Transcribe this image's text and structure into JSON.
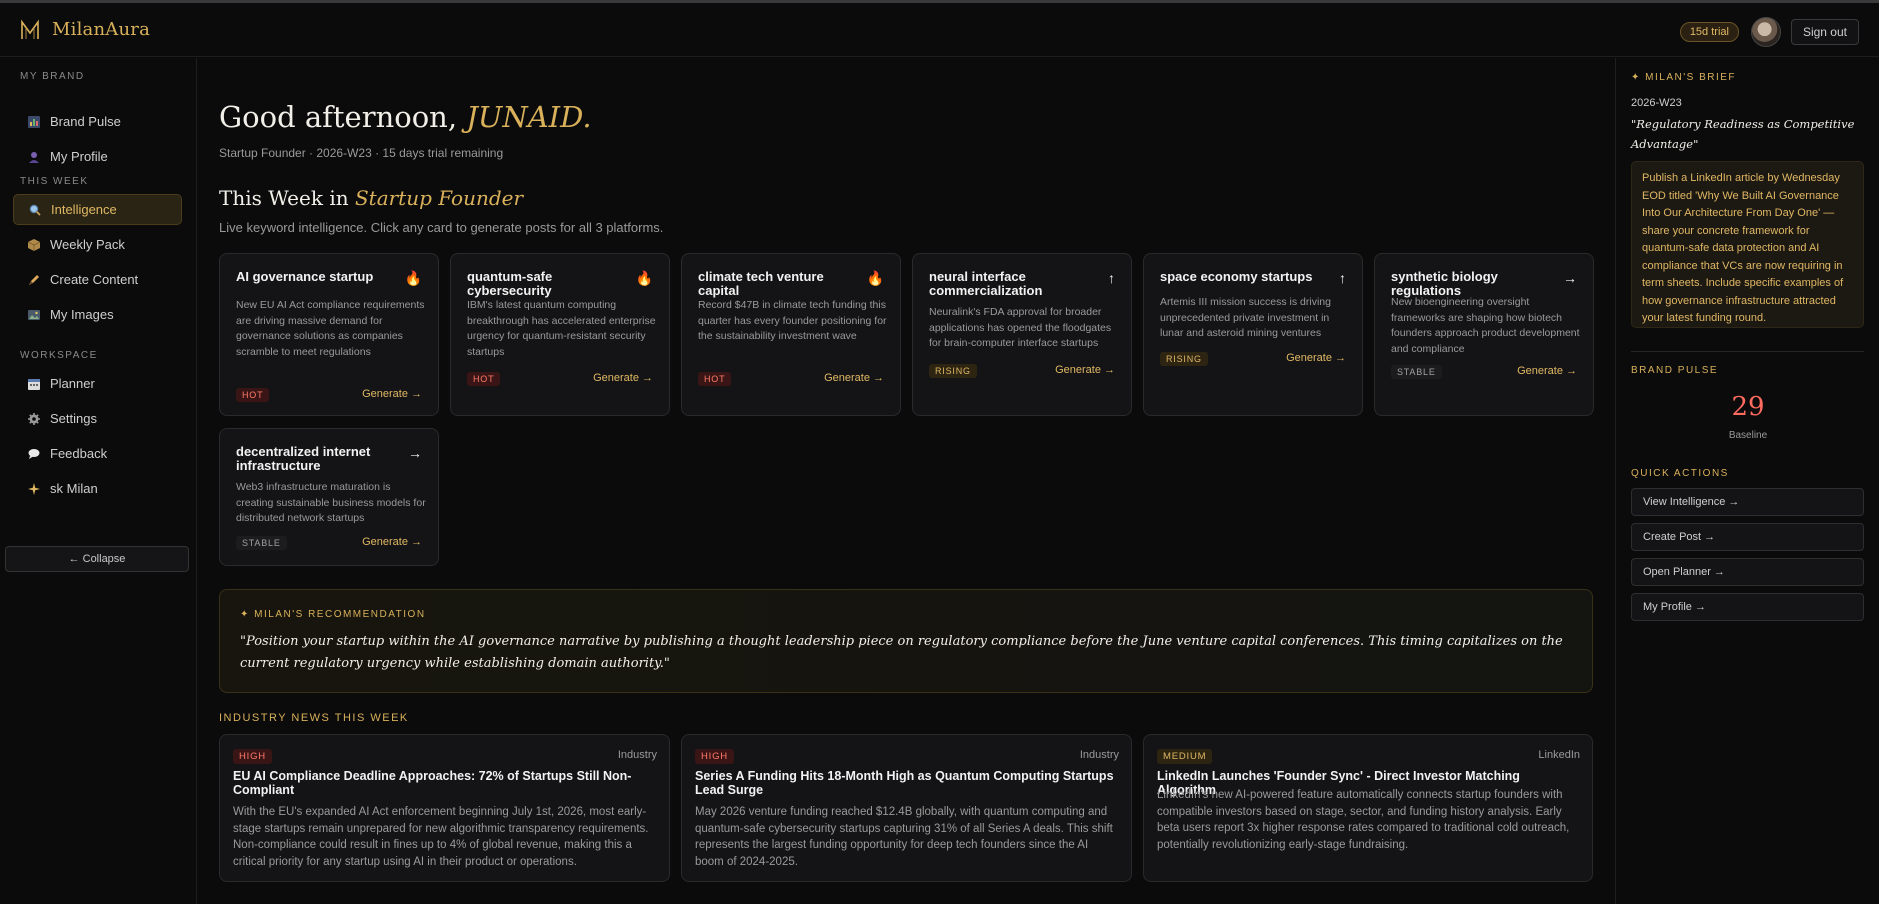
{
  "app": {
    "name": "MilanAura",
    "trial_badge": "15d trial",
    "signout": "Sign out"
  },
  "sidebar": {
    "sections": [
      {
        "label": "MY BRAND"
      },
      {
        "label": "THIS WEEK"
      },
      {
        "label": "WORKSPACE"
      }
    ],
    "items": [
      {
        "label": "Brand Pulse",
        "icon": "chart-icon"
      },
      {
        "label": "My Profile",
        "icon": "user-icon"
      },
      {
        "label": "Intelligence",
        "icon": "search-icon",
        "active": true
      },
      {
        "label": "Weekly Pack",
        "icon": "package-icon"
      },
      {
        "label": "Create Content",
        "icon": "pen-icon"
      },
      {
        "label": "My Images",
        "icon": "image-icon"
      },
      {
        "label": "Planner",
        "icon": "calendar-icon"
      },
      {
        "label": "Settings",
        "icon": "gear-icon"
      },
      {
        "label": "Feedback",
        "icon": "chat-icon"
      },
      {
        "label": "sk Milan",
        "icon": "sparkle-icon"
      }
    ],
    "collapse": "← Collapse"
  },
  "main": {
    "greeting_prefix": "Good afternoon, ",
    "greeting_name": "JUNAID.",
    "subline": "Startup Founder · 2026-W23 · 15 days trial remaining",
    "week_title_prefix": "This Week in ",
    "week_title_industry": "Startup Founder",
    "week_sub": "Live keyword intelligence. Click any card to generate posts for all 3 platforms.",
    "generate_label": "Generate →",
    "cards": [
      {
        "title": "AI governance startup",
        "icon": "fire-icon",
        "desc": "New EU AI Act compliance requirements are driving massive demand for governance solutions as companies scramble to meet regulations",
        "tag": "HOT"
      },
      {
        "title": "quantum-safe cybersecurity",
        "icon": "fire-icon",
        "desc": "IBM's latest quantum computing breakthrough has accelerated enterprise urgency for quantum-resistant security startups",
        "tag": "HOT"
      },
      {
        "title": "climate tech venture capital",
        "icon": "fire-icon",
        "desc": "Record $47B in climate tech funding this quarter has every founder positioning for the sustainability investment wave",
        "tag": "HOT"
      },
      {
        "title": "neural interface commercialization",
        "icon": "arrow-up-icon",
        "desc": "Neuralink's FDA approval for broader applications has opened the floodgates for brain-computer interface startups",
        "tag": "RISING"
      },
      {
        "title": "space economy startups",
        "icon": "arrow-up-icon",
        "desc": "Artemis III mission success is driving unprecedented private investment in lunar and asteroid mining ventures",
        "tag": "RISING"
      },
      {
        "title": "synthetic biology regulations",
        "icon": "arrow-right-icon",
        "desc": "New bioengineering oversight frameworks are shaping how biotech founders approach product development and compliance",
        "tag": "STABLE"
      },
      {
        "title": "decentralized internet infrastructure",
        "icon": "arrow-right-icon",
        "desc": "Web3 infrastructure maturation is creating sustainable business models for distributed network startups",
        "tag": "STABLE"
      }
    ],
    "recommendation": {
      "label": "✦ MILAN'S RECOMMENDATION",
      "text": "\"Position your startup within the AI governance narrative by publishing a thought leadership piece on regulatory compliance before the June venture capital conferences. This timing capitalizes on the current regulatory urgency while establishing domain authority.\""
    },
    "news_label": "INDUSTRY NEWS THIS WEEK",
    "news": [
      {
        "tag": "HIGH",
        "source": "Industry",
        "title": "EU AI Compliance Deadline Approaches: 72% of Startups Still Non-Compliant",
        "body": "With the EU's expanded AI Act enforcement beginning July 1st, 2026, most early-stage startups remain unprepared for new algorithmic transparency requirements. Non-compliance could result in fines up to 4% of global revenue, making this a critical priority for any startup using AI in their product or operations."
      },
      {
        "tag": "HIGH",
        "source": "Industry",
        "title": "Series A Funding Hits 18-Month High as Quantum Computing Startups Lead Surge",
        "body": "May 2026 venture funding reached $12.4B globally, with quantum computing and quantum-safe cybersecurity startups capturing 31% of all Series A deals. This shift represents the largest funding opportunity for deep tech founders since the AI boom of 2024-2025."
      },
      {
        "tag": "MEDIUM",
        "source": "LinkedIn",
        "title": "LinkedIn Launches 'Founder Sync' - Direct Investor Matching Algorithm",
        "body": "LinkedIn's new AI-powered feature automatically connects startup founders with compatible investors based on stage, sector, and funding history analysis. Early beta users report 3x higher response rates compared to traditional cold outreach, potentially revolutionizing early-stage fundraising."
      }
    ]
  },
  "right": {
    "brief_label": "✦ MILAN'S BRIEF",
    "week": "2026-W23",
    "brief_title": "\"Regulatory Readiness as Competitive Advantage\"",
    "brief_body": "Publish a LinkedIn article by Wednesday EOD titled 'Why We Built AI Governance Into Our Architecture From Day One' — share your concrete framework for quantum-safe data protection and AI compliance that VCs are now requiring in term sheets. Include specific examples of how governance infrastructure attracted your latest funding round.",
    "pulse_label": "BRAND PULSE",
    "pulse_value": "29",
    "pulse_caption": "Baseline",
    "quick_label": "QUICK ACTIONS",
    "quick_actions": [
      "View Intelligence →",
      "Create Post →",
      "Open Planner →",
      "My Profile →"
    ]
  },
  "colors": {
    "accent": "#d9b15a",
    "hot": "#ff7a6a",
    "background": "#0b0b0c",
    "card": "#141416"
  }
}
